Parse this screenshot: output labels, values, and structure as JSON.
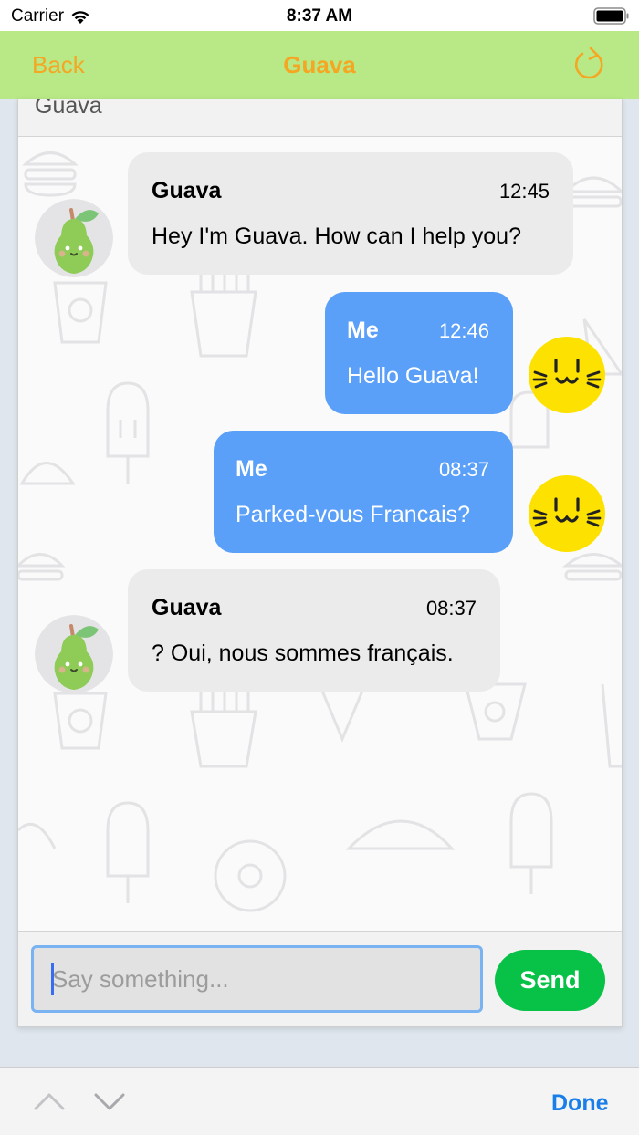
{
  "status_bar": {
    "carrier": "Carrier",
    "time": "8:37 AM"
  },
  "nav": {
    "back_label": "Back",
    "title": "Guava",
    "refresh_icon": "refresh-icon",
    "tint_color": "#f5a623",
    "background_color": "#b8e986"
  },
  "chat": {
    "header_text": "Guava",
    "messages": [
      {
        "sender": "Guava",
        "time": "12:45",
        "text": "Hey I'm Guava. How can I help you?",
        "from_me": false
      },
      {
        "sender": "Me",
        "time": "12:46",
        "text": "Hello Guava!",
        "from_me": true
      },
      {
        "sender": "Me",
        "time": "08:37",
        "text": "Parked-vous Francais?",
        "from_me": true
      },
      {
        "sender": "Guava",
        "time": "08:37",
        "text": "? Oui, nous sommes français.",
        "from_me": false
      }
    ],
    "bot_bubble_color": "#ebebeb",
    "my_bubble_color": "#5a9ff8"
  },
  "composer": {
    "placeholder": "Say something...",
    "value": "",
    "send_label": "Send",
    "send_color": "#08c147"
  },
  "keyboard_toolbar": {
    "done_label": "Done"
  }
}
